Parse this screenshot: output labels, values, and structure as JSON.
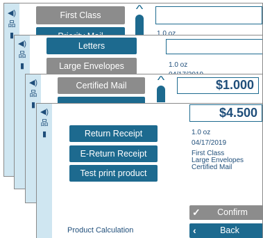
{
  "colors": {
    "accent": "#1d6a8f",
    "sidebar": "#cfe6f1",
    "gray_button": "#8c8c8c",
    "text": "#1f4e7a"
  },
  "sidebar_icons": [
    "speaker-icon",
    "network-icon",
    "book-icon"
  ],
  "screen1": {
    "class_button": "First Class",
    "class_button_partial": "Priority Mail",
    "weight": "1.0 oz"
  },
  "screen2": {
    "letters_button": "Letters",
    "large_envelopes_button": "Large Envelopes",
    "weight": "1.0 oz",
    "date": "04/17/2019"
  },
  "screen3": {
    "certified_mail_button": "Certified Mail",
    "price": "$1.000"
  },
  "screen4": {
    "price": "$4.500",
    "buttons": {
      "return_receipt": "Return Receipt",
      "e_return_receipt": "E-Return Receipt",
      "test_print": "Test print product"
    },
    "summary": {
      "weight": "1.0 oz",
      "date": "04/17/2019",
      "items": [
        "First Class",
        "Large Envelopes",
        "Certified Mail"
      ]
    },
    "confirm_button": "Confirm",
    "back_button": "Back",
    "footer_title": "Product Calculation"
  }
}
